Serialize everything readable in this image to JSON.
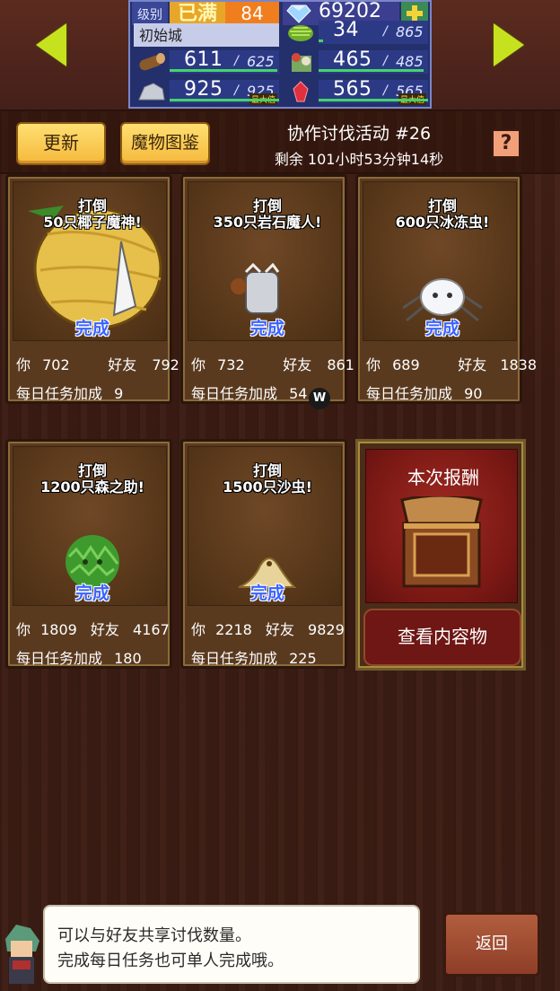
{
  "top": {
    "rank_label": "级别",
    "rank_value": "已满",
    "rank_number": "84",
    "gems": "69202",
    "town_name": "初始城",
    "stats": [
      {
        "name": "wood",
        "icon": "wood-icon",
        "current": "611",
        "max": "625",
        "progress": 0.98
      },
      {
        "name": "grass",
        "icon": "grass-icon",
        "current": "34",
        "max": "865",
        "progress": 0.04
      },
      {
        "name": "food",
        "icon": "food-icon",
        "current": "465",
        "max": "485",
        "progress": 0.96
      },
      {
        "name": "ore",
        "icon": "ore-icon",
        "current": "925",
        "max": "925",
        "progress": 1.0,
        "max_badge": "最大值"
      },
      {
        "name": "crystal",
        "icon": "crystal-icon",
        "current": "565",
        "max": "565",
        "progress": 1.0,
        "max_badge": "最大值"
      }
    ]
  },
  "header": {
    "refresh_label": "更新",
    "monster_book_label": "魔物图鉴",
    "event_title": "协作讨伐活动 #26",
    "time_remaining": "剩余 101小时53分钟14秒",
    "help_label": "?"
  },
  "cards": [
    {
      "line1": "打倒",
      "line2": "50只椰子魔神!",
      "done": "完成",
      "you_label": "你",
      "you": "702",
      "friend_label": "好友",
      "friend": "792",
      "bonus_label": "每日任务加成",
      "bonus": "9"
    },
    {
      "line1": "打倒",
      "line2": "350只岩石魔人!",
      "done": "完成",
      "you_label": "你",
      "you": "732",
      "friend_label": "好友",
      "friend": "861",
      "bonus_label": "每日任务加成",
      "bonus": "54"
    },
    {
      "line1": "打倒",
      "line2": "600只冰冻虫!",
      "done": "完成",
      "you_label": "你",
      "you": "689",
      "friend_label": "好友",
      "friend": "1838",
      "bonus_label": "每日任务加成",
      "bonus": "90"
    },
    {
      "line1": "打倒",
      "line2": "1200只森之助!",
      "done": "完成",
      "you_label": "你",
      "you": "1809",
      "friend_label": "好友",
      "friend": "4167",
      "bonus_label": "每日任务加成",
      "bonus": "180"
    },
    {
      "line1": "打倒",
      "line2": "1500只沙虫!",
      "done": "完成",
      "you_label": "你",
      "you": "2218",
      "friend_label": "好友",
      "friend": "9829",
      "bonus_label": "每日任务加成",
      "bonus": "225"
    }
  ],
  "reward": {
    "title": "本次报酬",
    "view_label": "查看内容物"
  },
  "dialog": {
    "line1": "可以与好友共享讨伐数量。",
    "line2": "完成每日任务也可单人完成哦。"
  },
  "back_label": "返回",
  "overlay_badge": "W"
}
